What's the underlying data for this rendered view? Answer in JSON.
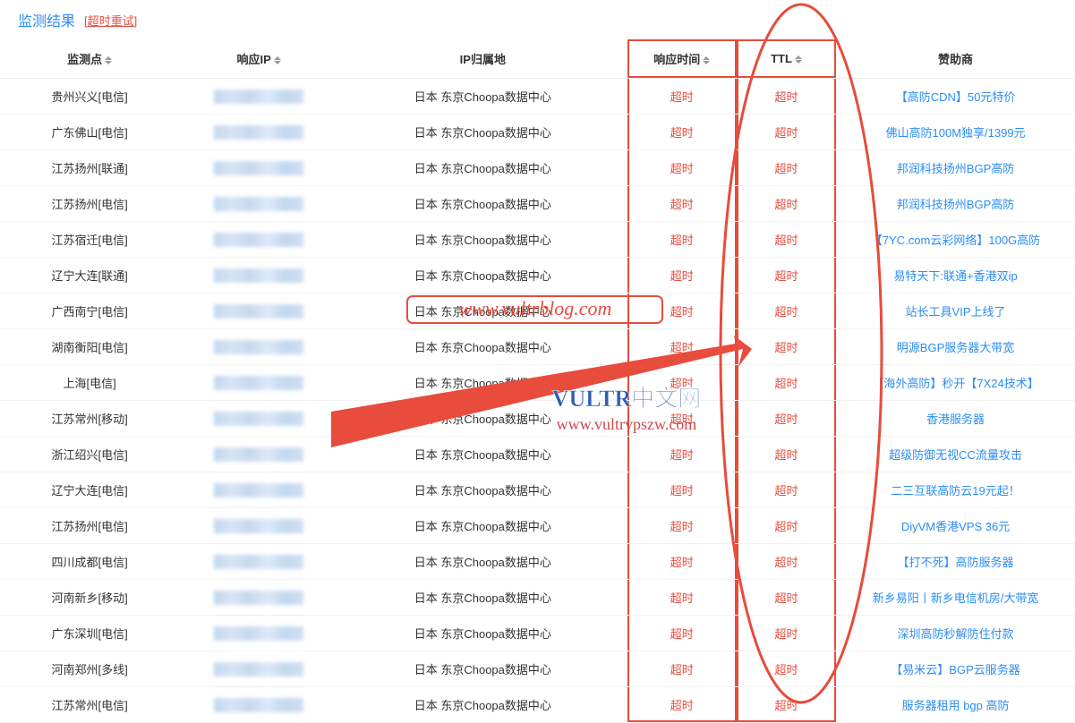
{
  "header": {
    "title": "监测结果",
    "retry_label": "[超时重试]"
  },
  "columns": {
    "point": "监测点",
    "ip": "响应IP",
    "location": "IP归属地",
    "time": "响应时间",
    "ttl": "TTL",
    "sponsor": "赞助商"
  },
  "watermark": {
    "top": "www.vultrblog.com",
    "middle": "VULTR中文网",
    "bottom": "www.vultrvpszw.com"
  },
  "rows": [
    {
      "point": "贵州兴义[电信]",
      "location": "日本 东京Choopa数据中心",
      "time": "超时",
      "ttl": "超时",
      "sponsor": "【高防CDN】50元特价"
    },
    {
      "point": "广东佛山[电信]",
      "location": "日本 东京Choopa数据中心",
      "time": "超时",
      "ttl": "超时",
      "sponsor": "佛山高防100M独享/1399元"
    },
    {
      "point": "江苏扬州[联通]",
      "location": "日本 东京Choopa数据中心",
      "time": "超时",
      "ttl": "超时",
      "sponsor": "邦润科技扬州BGP高防"
    },
    {
      "point": "江苏扬州[电信]",
      "location": "日本 东京Choopa数据中心",
      "time": "超时",
      "ttl": "超时",
      "sponsor": "邦润科技扬州BGP高防"
    },
    {
      "point": "江苏宿迁[电信]",
      "location": "日本 东京Choopa数据中心",
      "time": "超时",
      "ttl": "超时",
      "sponsor": "【7YC.com云彩网络】100G高防"
    },
    {
      "point": "辽宁大连[联通]",
      "location": "日本 东京Choopa数据中心",
      "time": "超时",
      "ttl": "超时",
      "sponsor": "易特天下:联通+香港双ip"
    },
    {
      "point": "广西南宁[电信]",
      "location": "日本 东京Choopa数据中心",
      "time": "超时",
      "ttl": "超时",
      "sponsor": "站长工具VIP上线了"
    },
    {
      "point": "湖南衡阳[电信]",
      "location": "日本 东京Choopa数据中心",
      "time": "超时",
      "ttl": "超时",
      "sponsor": "明源BGP服务器大带宽"
    },
    {
      "point": "上海[电信]",
      "location": "日本 东京Choopa数据中心",
      "time": "超时",
      "ttl": "超时",
      "sponsor": "【海外高防】秒开【7X24技术】"
    },
    {
      "point": "江苏常州[移动]",
      "location": "日本 东京Choopa数据中心",
      "time": "超时",
      "ttl": "超时",
      "sponsor": "香港服务器"
    },
    {
      "point": "浙江绍兴[电信]",
      "location": "日本 东京Choopa数据中心",
      "time": "超时",
      "ttl": "超时",
      "sponsor": "超级防御无视CC流量攻击"
    },
    {
      "point": "辽宁大连[电信]",
      "location": "日本 东京Choopa数据中心",
      "time": "超时",
      "ttl": "超时",
      "sponsor": "二三互联高防云19元起！"
    },
    {
      "point": "江苏扬州[电信]",
      "location": "日本 东京Choopa数据中心",
      "time": "超时",
      "ttl": "超时",
      "sponsor": "DiyVM香港VPS 36元"
    },
    {
      "point": "四川成都[电信]",
      "location": "日本 东京Choopa数据中心",
      "time": "超时",
      "ttl": "超时",
      "sponsor": "【打不死】高防服务器"
    },
    {
      "point": "河南新乡[移动]",
      "location": "日本 东京Choopa数据中心",
      "time": "超时",
      "ttl": "超时",
      "sponsor": "新乡易阳丨新乡电信机房/大带宽"
    },
    {
      "point": "广东深圳[电信]",
      "location": "日本 东京Choopa数据中心",
      "time": "超时",
      "ttl": "超时",
      "sponsor": "深圳高防秒解防住付款"
    },
    {
      "point": "河南郑州[多线]",
      "location": "日本 东京Choopa数据中心",
      "time": "超时",
      "ttl": "超时",
      "sponsor": "【易米云】BGP云服务器"
    },
    {
      "point": "江苏常州[电信]",
      "location": "日本 东京Choopa数据中心",
      "time": "超时",
      "ttl": "超时",
      "sponsor": "服务器租用 bgp 高防"
    }
  ]
}
